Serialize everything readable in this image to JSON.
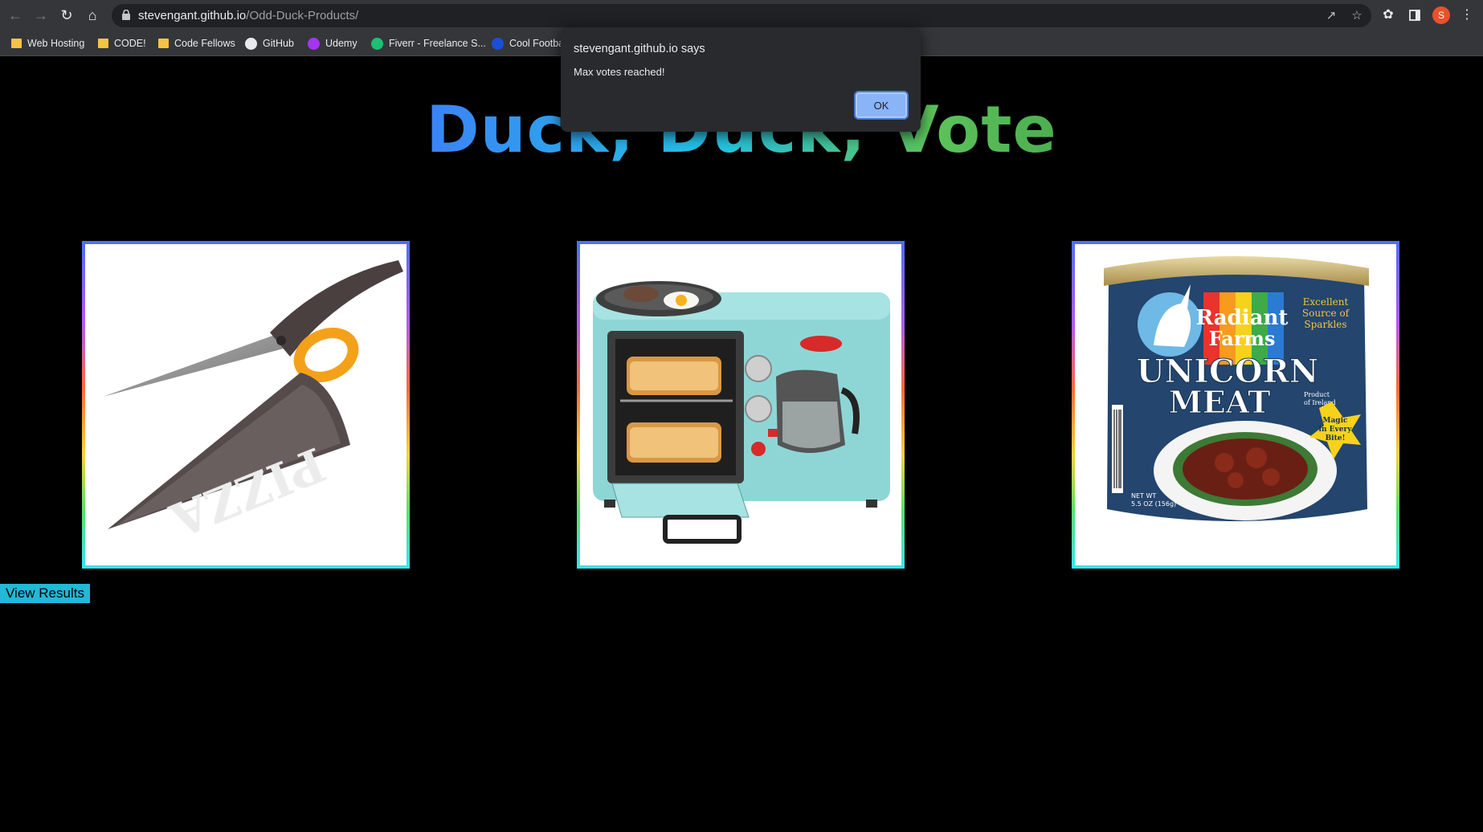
{
  "browser": {
    "url_host": "stevengant.github.io",
    "url_path": "/Odd-Duck-Products/",
    "profile_initial": "S",
    "bookmarks": [
      {
        "label": "Web Hosting",
        "icon": "folder-icon"
      },
      {
        "label": "CODE!",
        "icon": "folder-icon"
      },
      {
        "label": "Code Fellows",
        "icon": "folder-icon"
      },
      {
        "label": "GitHub",
        "icon": "github-icon"
      },
      {
        "label": "Udemy",
        "icon": "udemy-icon"
      },
      {
        "label": "Fiverr - Freelance S...",
        "icon": "fiverr-icon"
      },
      {
        "label": "Cool Footba",
        "icon": "globe-icon"
      }
    ]
  },
  "page": {
    "title": "Duck, Duck, Vote",
    "results_button": "View Results",
    "products": [
      {
        "name": "pizza-scissors"
      },
      {
        "name": "breakfast-maker"
      },
      {
        "name": "unicorn-meat"
      }
    ]
  },
  "product_text": {
    "pizza": "PIZZA",
    "radiant": "Radiant",
    "farms": "Farms",
    "unicorn": "UNICORN",
    "meat": "MEAT",
    "excellent": "Excellent",
    "source": "Source of",
    "sparkles": "Sparkles",
    "magic1": "Magic",
    "magic2": "in Every",
    "magic3": "Bite!",
    "netwt": "NET WT",
    "oz": "5.5 OZ (156g)",
    "product_of": "Product",
    "of_ireland": "of Ireland"
  },
  "dialog": {
    "title": "stevengant.github.io says",
    "message": "Max votes reached!",
    "ok_label": "OK"
  },
  "colors": {
    "title_gradient": [
      "#3b82f6",
      "#22c3e6",
      "#5cc35a"
    ],
    "results_button": "#22b8d6",
    "ok_button": "#8ab4f8"
  }
}
